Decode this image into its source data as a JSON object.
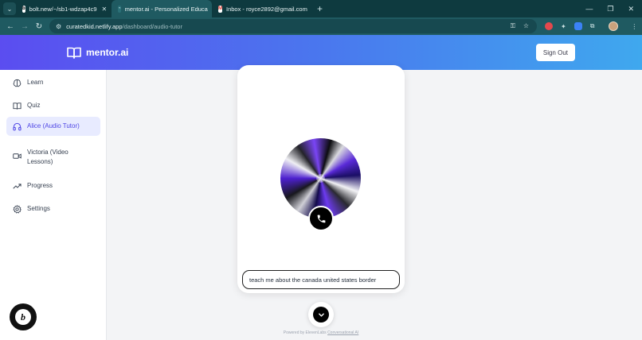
{
  "browser": {
    "tabs": [
      {
        "title": "bolt.new/~/sb1-wdzap4c9",
        "favicon": "b"
      },
      {
        "title": "mentor.ai - Personalized Educa",
        "favicon": "m"
      },
      {
        "title": "Inbox - royce2892@gmail.com",
        "favicon": "M"
      }
    ],
    "url_host": "curatedkid.netlify.app",
    "url_path": "/dashboard/audio-tutor"
  },
  "header": {
    "brand": "mentor.ai",
    "signout_label": "Sign Out",
    "gradient_start": "#5b4df0",
    "gradient_end": "#3fa8ee"
  },
  "sidebar": {
    "items": [
      {
        "label": "Learn",
        "icon": "brain-icon"
      },
      {
        "label": "Quiz",
        "icon": "book-open-icon"
      },
      {
        "label": "Alice (Audio Tutor)",
        "icon": "headphones-icon"
      },
      {
        "label": "Victoria (Video Lessons)",
        "icon": "video-icon"
      },
      {
        "label": "Progress",
        "icon": "trending-up-icon"
      },
      {
        "label": "Settings",
        "icon": "gear-icon"
      }
    ],
    "active_color": "#4f46e5"
  },
  "tutor": {
    "input_value": "teach me about the canada united states border",
    "powered_prefix": "Powered by ElevenLabs",
    "powered_link": "Conversational AI"
  }
}
